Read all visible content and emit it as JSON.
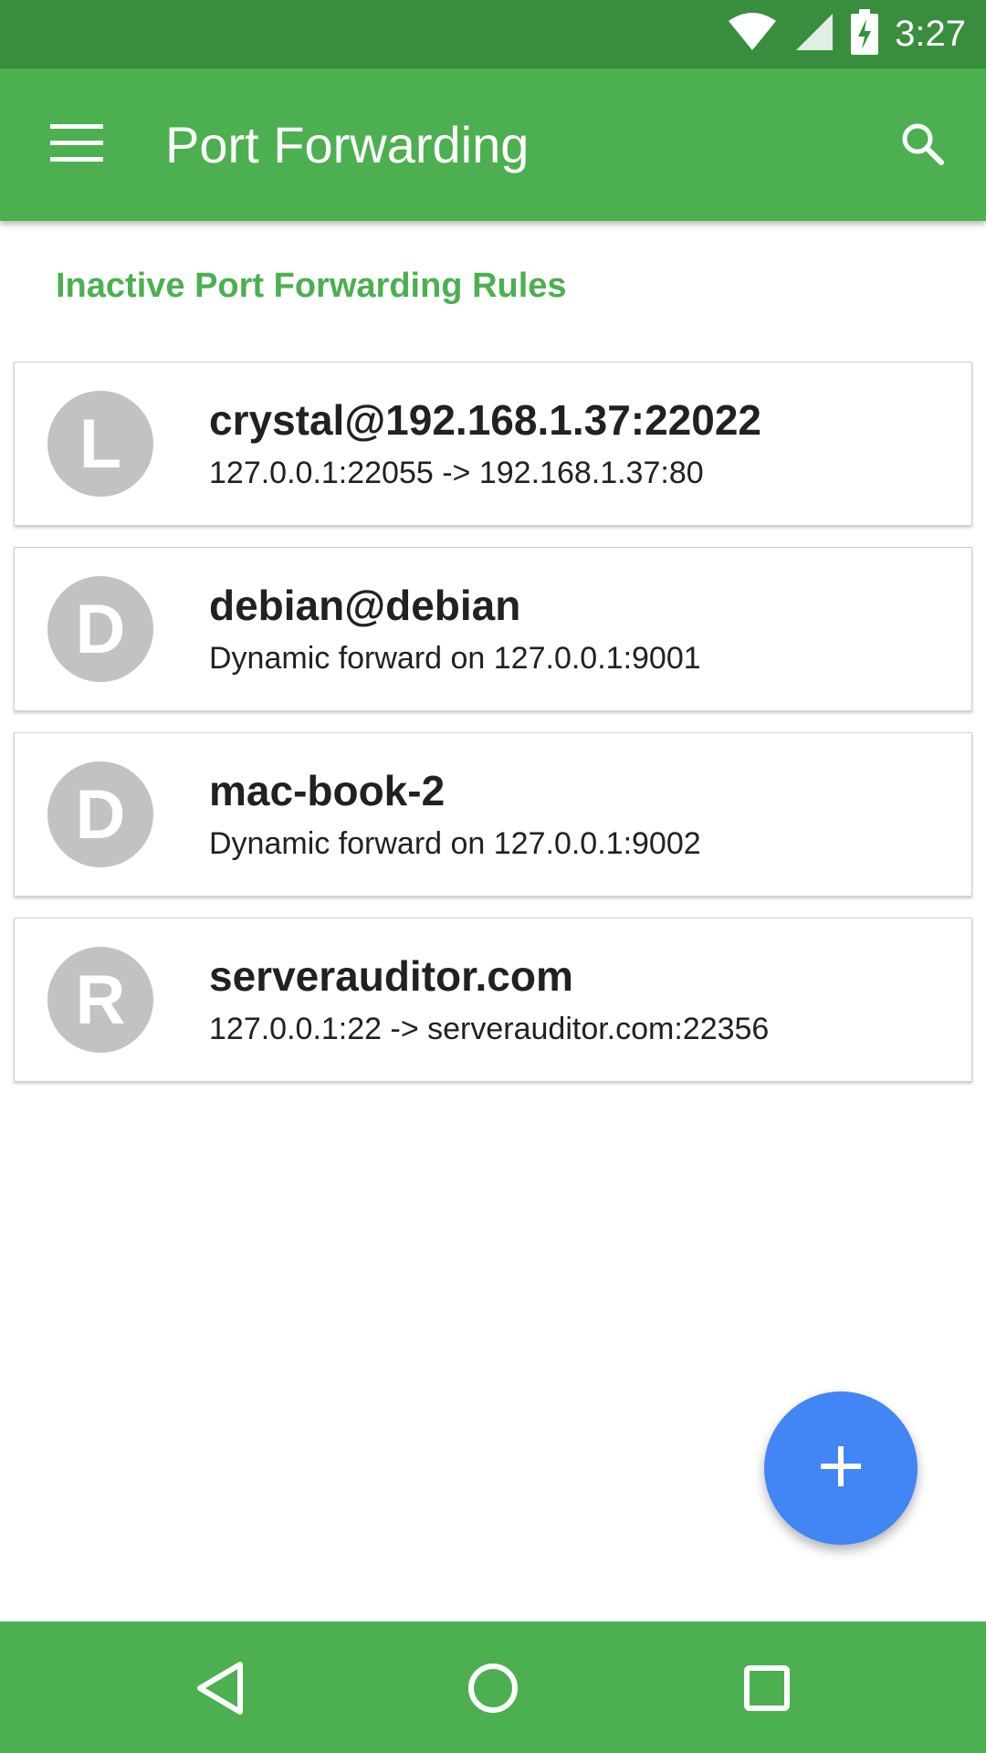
{
  "status_bar": {
    "time": "3:27",
    "icons": [
      "wifi-icon",
      "signal-icon",
      "battery-charging-icon"
    ]
  },
  "app_bar": {
    "title": "Port Forwarding",
    "menu_icon": "menu-icon",
    "search_icon": "search-icon"
  },
  "section": {
    "header": "Inactive Port Forwarding Rules"
  },
  "rules": [
    {
      "initial": "L",
      "title": "crystal@192.168.1.37:22022",
      "subtitle": "127.0.0.1:22055 -> 192.168.1.37:80"
    },
    {
      "initial": "D",
      "title": "debian@debian",
      "subtitle": "Dynamic forward on 127.0.0.1:9001"
    },
    {
      "initial": "D",
      "title": "mac-book-2",
      "subtitle": "Dynamic forward on 127.0.0.1:9002"
    },
    {
      "initial": "R",
      "title": "serverauditor.com",
      "subtitle": "127.0.0.1:22 -> serverauditor.com:22356"
    }
  ],
  "fab": {
    "icon": "plus-icon"
  },
  "nav_bar": {
    "icons": [
      "back-icon",
      "home-icon",
      "recents-icon"
    ]
  },
  "colors": {
    "status_bar": "#388e3c",
    "app_bar": "#4caf50",
    "accent": "#4caf50",
    "avatar": "#c2c2c2",
    "fab": "#4285f4"
  }
}
